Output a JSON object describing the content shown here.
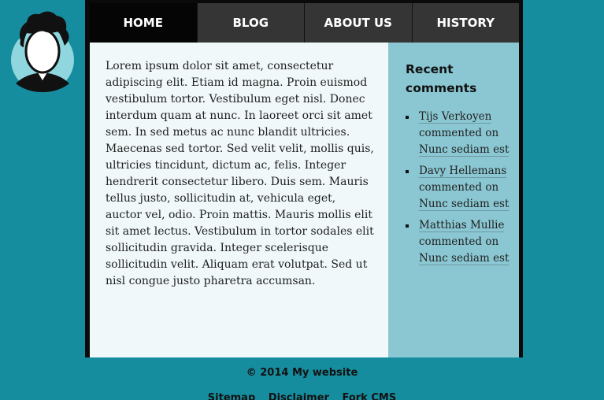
{
  "nav": {
    "items": [
      {
        "label": "HOME"
      },
      {
        "label": "BLOG"
      },
      {
        "label": "ABOUT US"
      },
      {
        "label": "HISTORY"
      }
    ]
  },
  "main": {
    "body": "Lorem ipsum dolor sit amet, consectetur adipiscing elit. Etiam id magna. Proin euismod vestibulum tortor. Vestibulum eget nisl. Donec interdum quam at nunc. In laoreet orci sit amet sem. In sed metus ac nunc blandit ultricies. Maecenas sed tortor. Sed velit velit, mollis quis, ultricies tincidunt, dictum ac, felis. Integer hendrerit consectetur libero. Duis sem. Mauris tellus justo, sollicitudin at, vehicula eget, auctor vel, odio. Proin mattis. Mauris mollis elit sit amet lectus. Vestibulum in tortor sodales elit sollicitudin gravida. Integer scelerisque sollicitudin velit. Aliquam erat volutpat. Sed ut nisl congue justo pharetra accumsan."
  },
  "sidebar": {
    "title": "Recent comments",
    "comments": [
      {
        "author": "Tijs Verkoyen",
        "verb": "commented on",
        "post": "Nunc sediam est"
      },
      {
        "author": "Davy Hellemans",
        "verb": "commented on",
        "post": "Nunc sediam est"
      },
      {
        "author": "Matthias Mullie",
        "verb": "commented on",
        "post": "Nunc sediam est"
      }
    ]
  },
  "footer": {
    "copyright": "© 2014 My website",
    "links": [
      "Sitemap",
      "Disclaimer",
      "Fork CMS"
    ]
  }
}
